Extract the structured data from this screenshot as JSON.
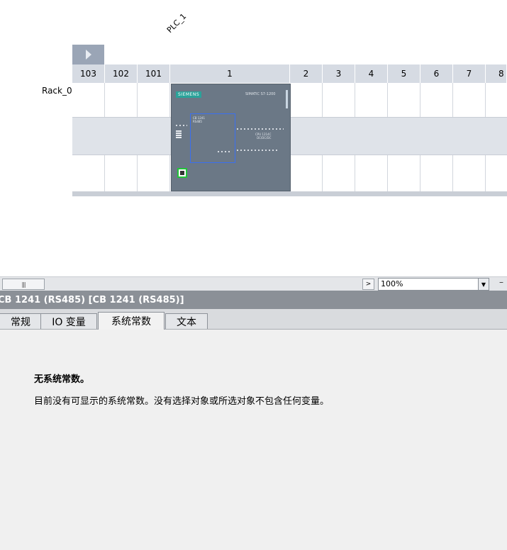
{
  "device_view": {
    "plc_name": "PLC_1",
    "rack_name": "Rack_0",
    "slots": [
      "103",
      "102",
      "101",
      "1",
      "2",
      "3",
      "4",
      "5",
      "6",
      "7",
      "8"
    ],
    "cpu": {
      "brand": "SIEMENS",
      "model": "SIMATIC S7-1200",
      "cb_label": "CB 1241\nRS485",
      "cpu_label": "CPU 1214C\nDC/DC/DC",
      "colors": {
        "body": "#6b7886",
        "cb_highlight": "#3a6ff0",
        "port_highlight": "#23c23a"
      }
    }
  },
  "scroll_bar": {
    "thumb_glyph": "|||",
    "right_arrow": ">",
    "zoom": "100%",
    "zoom_dropdown_icon": "▼",
    "zoom_out": "–"
  },
  "properties": {
    "title": "CB 1241 (RS485) [CB 1241 (RS485)]",
    "tabs": [
      {
        "label": "常规"
      },
      {
        "label": "IO 变量"
      },
      {
        "label": "系统常数"
      },
      {
        "label": "文本"
      }
    ],
    "active_tab": "系统常数",
    "message_title": "无系统常数。",
    "message_body": "目前没有可显示的系统常数。没有选择对象或所选对象不包含任何变量。"
  }
}
